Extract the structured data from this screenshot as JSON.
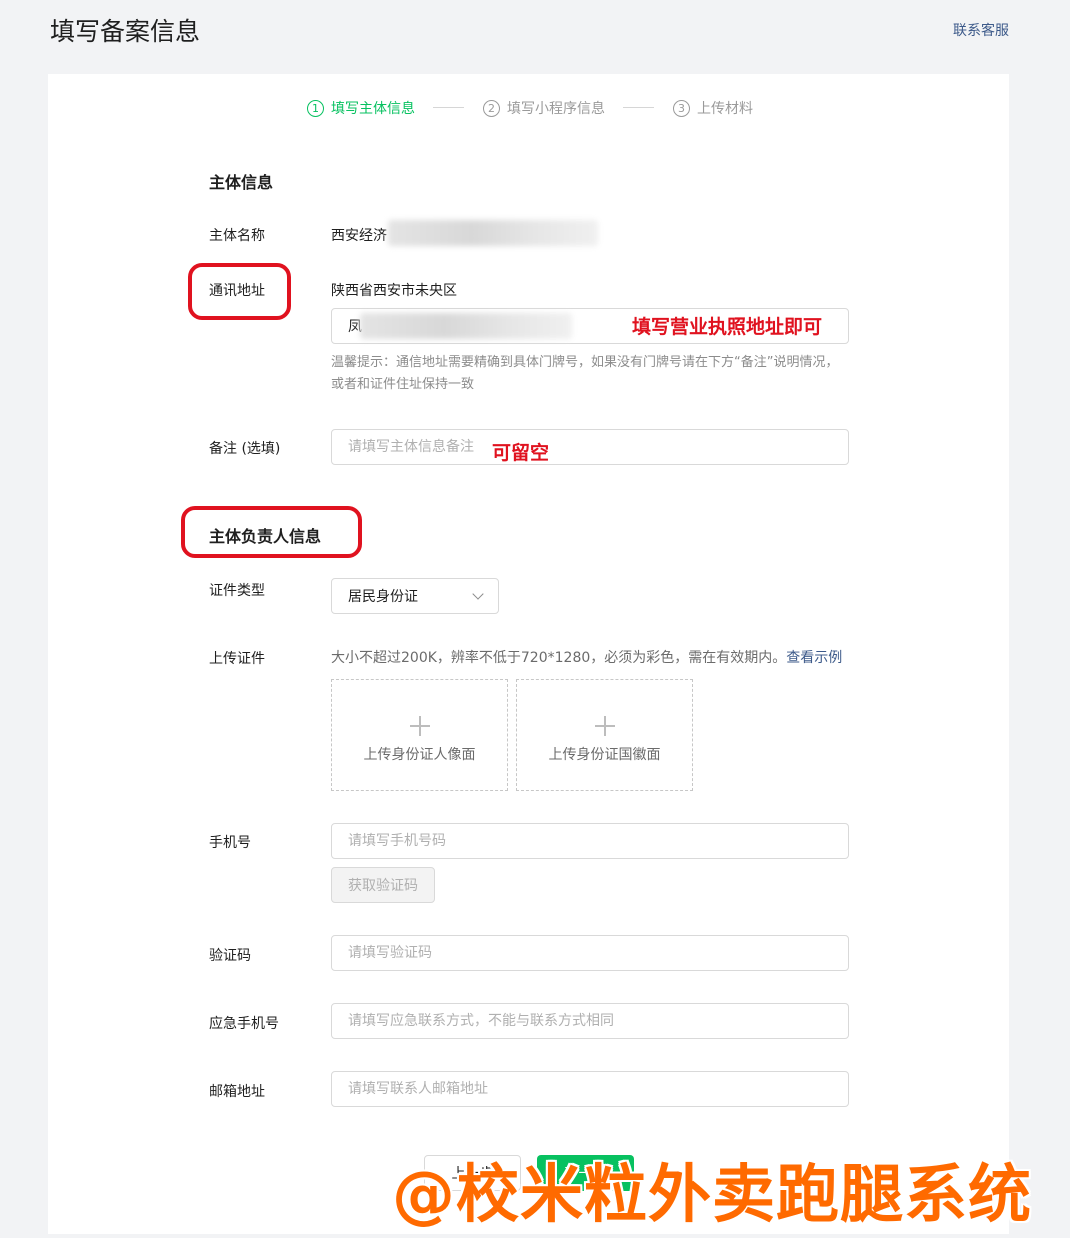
{
  "header": {
    "title": "填写备案信息",
    "contact_link": "联系客服"
  },
  "steps": [
    {
      "num": "1",
      "label": "填写主体信息"
    },
    {
      "num": "2",
      "label": "填写小程序信息"
    },
    {
      "num": "3",
      "label": "上传材料"
    }
  ],
  "subject": {
    "section_title": "主体信息",
    "name_label": "主体名称",
    "name_value": "西安经济",
    "address_label": "通讯地址",
    "address_region": "陕西省西安市未央区",
    "address_detail_value": "凤",
    "address_hint": "温馨提示：通信地址需要精确到具体门牌号，如果没有门牌号请在下方“备注”说明情况，或者和证件住址保持一致",
    "remark_label": "备注 (选填)",
    "remark_placeholder": "请填写主体信息备注"
  },
  "responsible": {
    "section_title": "主体负责人信息",
    "id_type_label": "证件类型",
    "id_type_value": "居民身份证",
    "upload_label": "上传证件",
    "upload_hint": "大小不超过200K，辨率不低于720*1280，必须为彩色，需在有效期内。",
    "upload_example_link": "查看示例",
    "upload_front": "上传身份证人像面",
    "upload_back": "上传身份证国徽面",
    "phone_label": "手机号",
    "phone_placeholder": "请填写手机号码",
    "get_code_button": "获取验证码",
    "code_label": "验证码",
    "code_placeholder": "请填写验证码",
    "emergency_label": "应急手机号",
    "emergency_placeholder": "请填写应急联系方式，不能与联系方式相同",
    "email_label": "邮箱地址",
    "email_placeholder": "请填写联系人邮箱地址"
  },
  "footer": {
    "back_button": "上一步",
    "next_button": "下一步"
  },
  "annotations": {
    "address_note": "填写营业执照地址即可",
    "remark_note": "可留空",
    "watermark": "@校米粒外卖跑腿系统"
  },
  "colors": {
    "accent": "#07c160",
    "annotation_red": "#e0121f",
    "watermark_orange": "#ff6a00",
    "link": "#3d5a8a"
  }
}
